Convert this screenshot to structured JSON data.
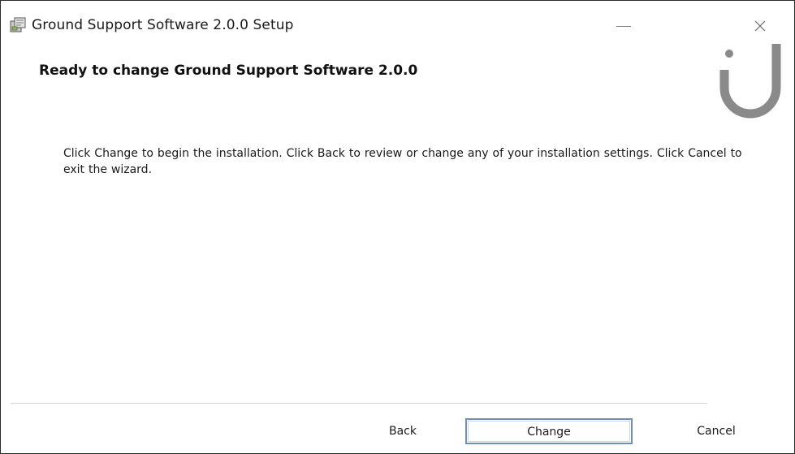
{
  "window": {
    "title": "Ground Support Software 2.0.0 Setup",
    "icon": "installer-package-icon"
  },
  "header": {
    "title": "Ready to change Ground Support Software 2.0.0",
    "logo": "brand-u-logo"
  },
  "body": {
    "instructions": "Click Change to begin the installation. Click Back to review or change any of your installation settings. Click Cancel to exit the wizard."
  },
  "footer": {
    "back_label": "Back",
    "change_label": "Change",
    "cancel_label": "Cancel"
  },
  "colors": {
    "logo_gray": "#8a8a8a",
    "focus_border": "#6f8db7"
  }
}
